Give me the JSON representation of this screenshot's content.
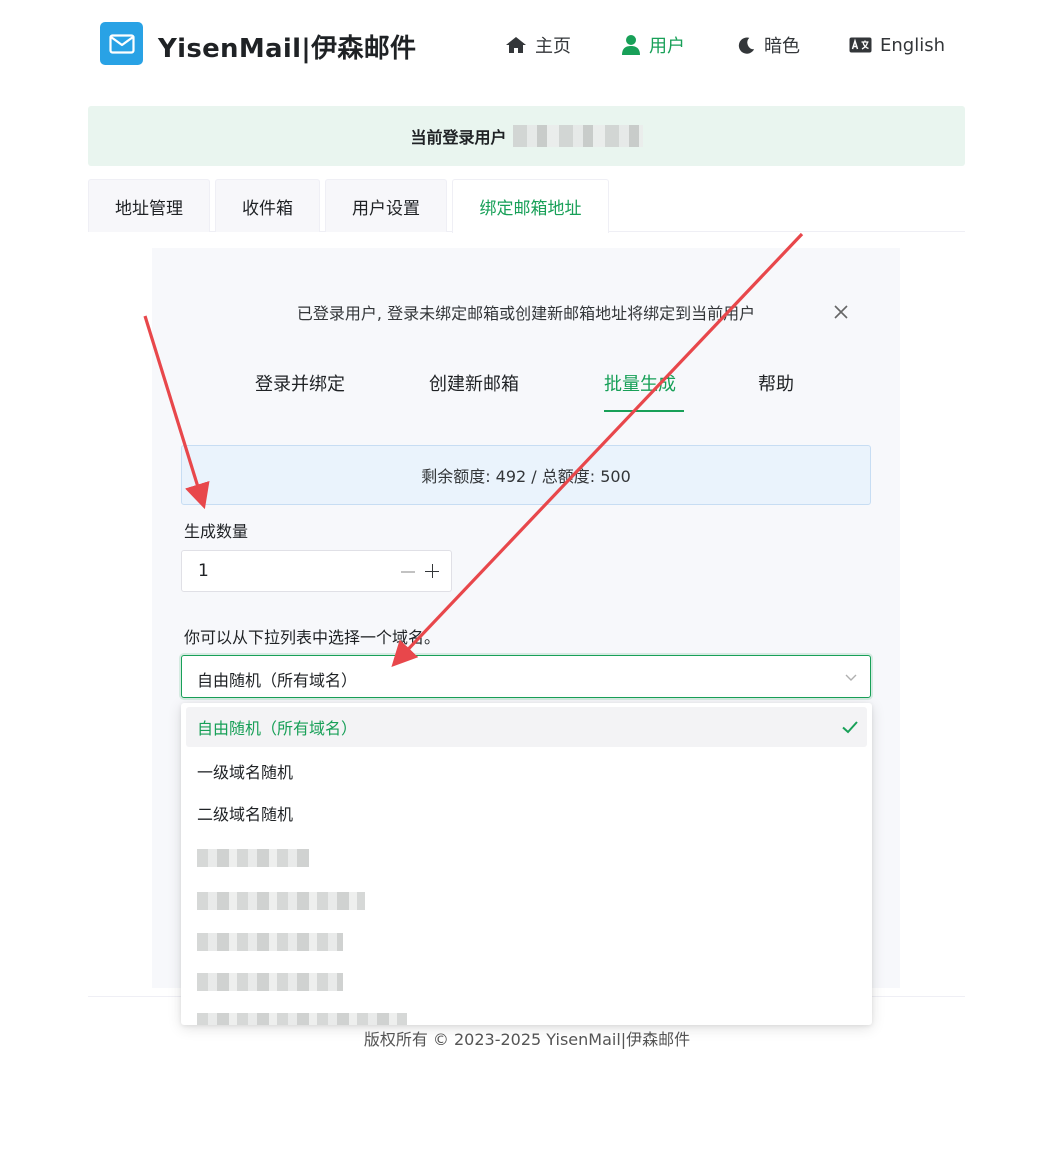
{
  "header": {
    "brand": "YisenMail|伊森邮件",
    "nav": [
      {
        "label": "主页",
        "icon": "home-icon"
      },
      {
        "label": "用户",
        "icon": "user-icon",
        "active": true
      },
      {
        "label": "暗色",
        "icon": "moon-icon"
      },
      {
        "label": "English",
        "icon": "translate-icon"
      }
    ]
  },
  "banner": {
    "text": "当前登录用户",
    "user": "[redacted]"
  },
  "tabs": [
    {
      "label": "地址管理"
    },
    {
      "label": "收件箱"
    },
    {
      "label": "用户设置"
    },
    {
      "label": "绑定邮箱地址",
      "active": true
    }
  ],
  "card": {
    "notice": "已登录用户, 登录未绑定邮箱或创建新邮箱地址将绑定到当前用户",
    "subtabs": [
      {
        "label": "登录并绑定"
      },
      {
        "label": "创建新邮箱"
      },
      {
        "label": "批量生成",
        "active": true
      },
      {
        "label": "帮助"
      }
    ],
    "quota": "剩余额度: 492 / 总额度: 500",
    "count_label": "生成数量",
    "count_value": "1",
    "domain_label": "你可以从下拉列表中选择一个域名。",
    "domain_selected": "自由随机（所有域名）"
  },
  "dropdown": {
    "options": [
      {
        "label": "自由随机（所有域名）",
        "selected": true
      },
      {
        "label": "一级域名随机"
      },
      {
        "label": "二级域名随机"
      },
      {
        "label": "",
        "redacted": true
      },
      {
        "label": "",
        "redacted": true
      },
      {
        "label": "",
        "redacted": true
      },
      {
        "label": "",
        "redacted": true
      },
      {
        "label": "",
        "redacted": true
      }
    ]
  },
  "footer": {
    "text": "版权所有 © 2023-2025   YisenMail|伊森邮件"
  },
  "colors": {
    "accent": "#18a058",
    "logo": "#29a2e5",
    "banner_bg": "#e9f5ef",
    "quota_bg": "#eaf3fc",
    "annotation_arrow": "#e8474b"
  }
}
